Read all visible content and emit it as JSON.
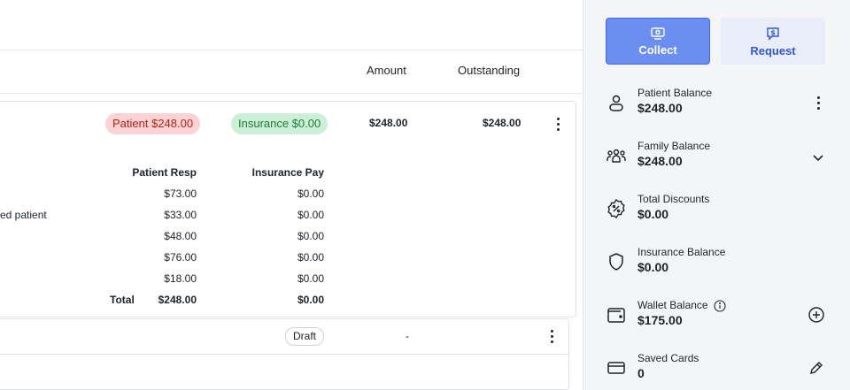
{
  "columns": {
    "amount": "Amount",
    "outstanding": "Outstanding"
  },
  "summary": {
    "patient_pill": "Patient $248.00",
    "insurance_pill": "Insurance $0.00",
    "amount": "$248.00",
    "outstanding": "$248.00"
  },
  "breakdown": {
    "headers": {
      "patient_resp": "Patient Resp",
      "insurance_pay": "Insurance Pay"
    },
    "rows": [
      {
        "desc": "",
        "patient": "$73.00",
        "insurance": "$0.00"
      },
      {
        "desc": "ed patient",
        "patient": "$33.00",
        "insurance": "$0.00"
      },
      {
        "desc": "",
        "patient": "$48.00",
        "insurance": "$0.00"
      },
      {
        "desc": "",
        "patient": "$76.00",
        "insurance": "$0.00"
      },
      {
        "desc": "",
        "patient": "$18.00",
        "insurance": "$0.00"
      }
    ],
    "total_label": "Total",
    "total_patient": "$248.00",
    "total_insurance": "$0.00"
  },
  "second_item": {
    "status": "Draft",
    "amount": "-"
  },
  "sidebar": {
    "collect_label": "Collect",
    "request_label": "Request",
    "balances": [
      {
        "label": "Patient Balance",
        "value": "$248.00",
        "icon": "person-icon",
        "action": "more-icon"
      },
      {
        "label": "Family Balance",
        "value": "$248.00",
        "icon": "family-icon",
        "action": "chevron-down-icon"
      },
      {
        "label": "Total Discounts",
        "value": "$0.00",
        "icon": "discount-badge-icon",
        "action": ""
      },
      {
        "label": "Insurance Balance",
        "value": "$0.00",
        "icon": "shield-icon",
        "action": ""
      },
      {
        "label": "Wallet Balance",
        "value": "$175.00",
        "icon": "wallet-icon",
        "action": "add-circle-icon"
      },
      {
        "label": "Saved Cards",
        "value": "0",
        "icon": "card-icon",
        "action": "pencil-icon"
      }
    ]
  },
  "colors": {
    "accent": "#6b8ef2",
    "patient_pill_bg": "#fbd3d3",
    "insurance_pill_bg": "#cbf0d6"
  }
}
